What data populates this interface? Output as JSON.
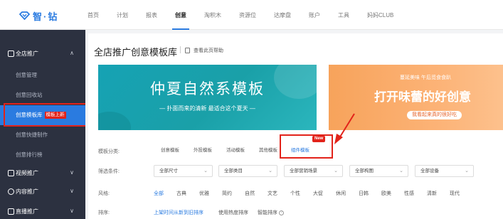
{
  "brand": {
    "name": "智·钻",
    "color": "#2a7be0"
  },
  "nav": [
    {
      "label": "首页",
      "active": false
    },
    {
      "label": "计划",
      "active": false
    },
    {
      "label": "报表",
      "active": false
    },
    {
      "label": "创意",
      "active": true
    },
    {
      "label": "淘积木",
      "active": false
    },
    {
      "label": "资源位",
      "active": false
    },
    {
      "label": "达摩盘",
      "active": false
    },
    {
      "label": "账户",
      "active": false
    },
    {
      "label": "工具",
      "active": false
    },
    {
      "label": "妈妈CLUB",
      "active": false
    }
  ],
  "sidebar": {
    "groups": [
      {
        "label": "全店推广",
        "icon": "store-icon",
        "expanded": true
      },
      {
        "label": "视频推广",
        "icon": "video-icon",
        "expanded": false
      },
      {
        "label": "内容推广",
        "icon": "content-icon",
        "expanded": false
      },
      {
        "label": "直播推广",
        "icon": "live-icon",
        "expanded": false
      }
    ],
    "items": [
      {
        "label": "创意管理",
        "active": false
      },
      {
        "label": "创意回收站",
        "active": false
      },
      {
        "label": "创意模板库",
        "active": true,
        "badge": "模板上新"
      },
      {
        "label": "创意快捷制作",
        "active": false
      },
      {
        "label": "创意排行榜",
        "active": false
      }
    ]
  },
  "main": {
    "title": "全店推广创意模板库",
    "help_link": "查看此页帮助",
    "banner1": {
      "title": "仲夏自然系模板",
      "subtitle": "— 扑面而来的清新 最适合这个夏天 —"
    },
    "banner2": {
      "small": "蔓延美味 午后觅食食趴",
      "title": "打开味蕾的好创意",
      "button": "我看起来真的很好吃"
    },
    "category": {
      "label": "模板分类:",
      "items": [
        {
          "label": "创意模板",
          "active": false
        },
        {
          "label": "外投模板",
          "active": false
        },
        {
          "label": "活动模板",
          "active": false
        },
        {
          "label": "其他模板",
          "active": false
        },
        {
          "label": "组件模板",
          "active": true
        }
      ],
      "new_tag": "New"
    },
    "filter": {
      "label": "筛选条件:",
      "selects": [
        "全部尺寸",
        "全部类目",
        "全部营销场景",
        "全部构图",
        "全部设备"
      ]
    },
    "style": {
      "label": "风格:",
      "items": [
        "全部",
        "古典",
        "优雅",
        "简约",
        "自然",
        "文艺",
        "个性",
        "大促",
        "休闲",
        "日韩",
        "欧美",
        "性感",
        "清新",
        "现代"
      ]
    },
    "sort": {
      "label": "排序:",
      "items": [
        {
          "label": "上架时间从新到旧排序",
          "active": true
        },
        {
          "label": "使用热度排序",
          "active": false
        },
        {
          "label": "智能排序",
          "active": false
        }
      ]
    }
  },
  "colors": {
    "accent": "#2a7be0",
    "highlight": "#e2231a",
    "sidebar_bg": "#2c3140"
  }
}
